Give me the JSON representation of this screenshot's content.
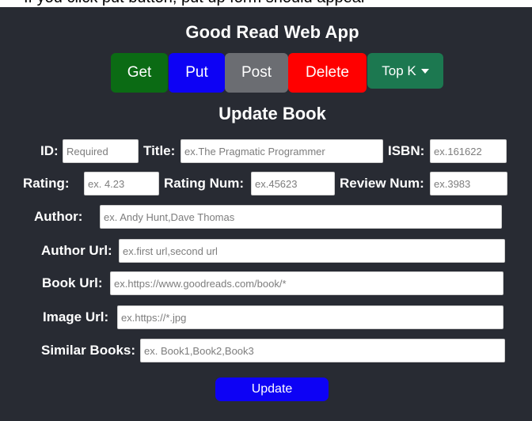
{
  "app": {
    "title": "Good Read Web App"
  },
  "nav": {
    "get": "Get",
    "put": "Put",
    "post": "Post",
    "delete": "Delete",
    "topk": "Top K",
    "topk_icon": "chevron-down-icon"
  },
  "colors": {
    "background": "#282b33",
    "get": "#0b6b14",
    "put": "#0d02f5",
    "post": "#6b6d72",
    "delete": "#ff0000",
    "topk": "#1c7850",
    "update": "#0d02f5"
  },
  "form": {
    "title": "Update Book",
    "fields": {
      "id": {
        "label": "ID:",
        "value": "",
        "placeholder": "Required"
      },
      "title": {
        "label": "Title:",
        "value": "",
        "placeholder": "ex.The Pragmatic Programmer"
      },
      "isbn": {
        "label": "ISBN:",
        "value": "",
        "placeholder": "ex.161622"
      },
      "rating": {
        "label": "Rating:",
        "value": "",
        "placeholder": "ex. 4.23"
      },
      "rating_num": {
        "label": "Rating Num:",
        "value": "",
        "placeholder": "ex.45623"
      },
      "review_num": {
        "label": "Review Num:",
        "value": "",
        "placeholder": "ex.3983"
      },
      "author": {
        "label": "Author:",
        "value": "",
        "placeholder": "ex. Andy Hunt,Dave Thomas"
      },
      "author_url": {
        "label": "Author Url:",
        "value": "",
        "placeholder": "ex.first url,second url"
      },
      "book_url": {
        "label": "Book Url:",
        "value": "",
        "placeholder": "ex.https://www.goodreads.com/book/*"
      },
      "image_url": {
        "label": "Image Url:",
        "value": "",
        "placeholder": "ex.https://*.jpg"
      },
      "similar_books": {
        "label": "Similar Books:",
        "value": "",
        "placeholder": "ex. Book1,Book2,Book3"
      }
    },
    "submit": "Update"
  }
}
